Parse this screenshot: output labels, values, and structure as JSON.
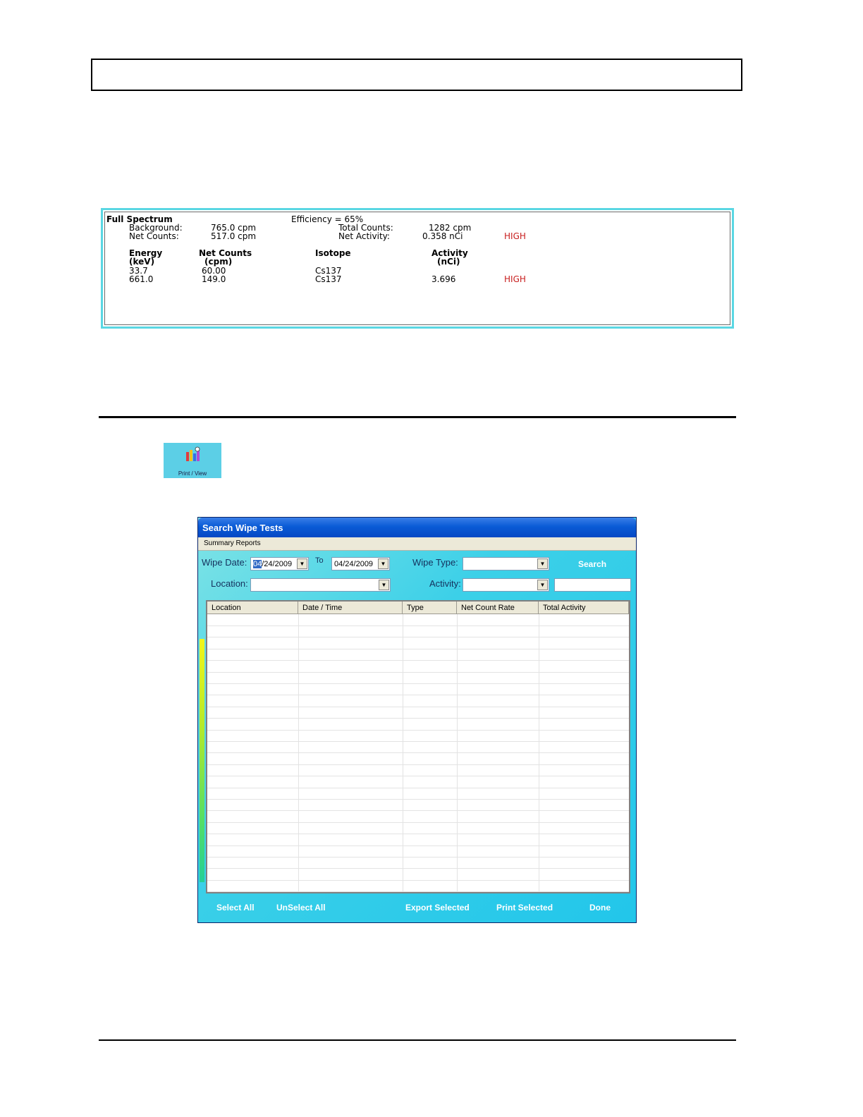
{
  "spectrum_report": {
    "heading": "Full Spectrum",
    "efficiency": "Efficiency = 65%",
    "background_label": "Background:",
    "background_value": "765.0 cpm",
    "net_counts_label": "Net Counts:",
    "net_counts_value": "517.0 cpm",
    "total_counts_label": "Total Counts:",
    "total_counts_value": "1282 cpm",
    "net_activity_label": "Net Activity:",
    "net_activity_value": "0.358 nCi",
    "net_activity_flag": "HIGH",
    "columns": {
      "energy": "Energy",
      "energy_unit": "(keV)",
      "net_counts": "Net Counts",
      "net_counts_unit": "(cpm)",
      "isotope": "Isotope",
      "activity": "Activity",
      "activity_unit": "(nCi)"
    },
    "rows": [
      {
        "energy": "33.7",
        "net_counts": "60.00",
        "isotope": "Cs137",
        "activity": "",
        "flag": ""
      },
      {
        "energy": "661.0",
        "net_counts": "149.0",
        "isotope": "Cs137",
        "activity": "3.696",
        "flag": "HIGH"
      }
    ],
    "colors": {
      "border": "#5ad7e3",
      "flag": "#c81e1e"
    }
  },
  "print_view_button": {
    "label": "Print / View",
    "icon": "chart-printer-icon",
    "color": "#5ccfe6"
  },
  "search_window": {
    "title": "Search Wipe Tests",
    "menu": [
      "Summary Reports"
    ],
    "wipe_date_label": "Wipe Date:",
    "from_date": {
      "selected": "04",
      "rest": "/24/2009"
    },
    "to_label": "To",
    "to_date": "04/24/2009",
    "wipe_type_label": "Wipe Type:",
    "wipe_type_value": "",
    "search_label": "Search",
    "location_label": "Location:",
    "location_value": "",
    "activity_label": "Activity:",
    "activity_value": "",
    "activity_text": "",
    "table_columns": [
      "Location",
      "Date / Time",
      "Type",
      "Net Count Rate",
      "Total Activity"
    ],
    "table_rows": [],
    "buttons": {
      "select_all": "Select All",
      "unselect_all": "UnSelect All",
      "export_selected": "Export Selected",
      "print_selected": "Print Selected",
      "done": "Done"
    },
    "colors": {
      "title_bar": "#0548c4",
      "background": "#22c6ea"
    }
  }
}
